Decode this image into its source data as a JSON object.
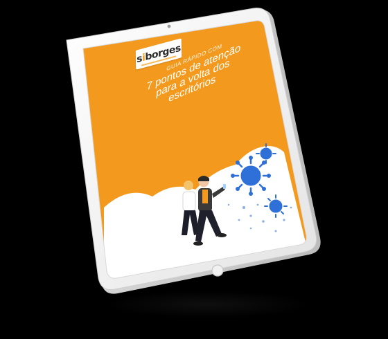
{
  "logo": {
    "brand_prefix": "s",
    "brand_accent": "i",
    "brand_suffix": "borges"
  },
  "cover": {
    "eyebrow": "GUIA RÁPIDO COM",
    "headline_line1": "7 pontos de atenção",
    "headline_line2": "para a volta dos",
    "headline_line3": "escritórios"
  },
  "colors": {
    "background": "#000000",
    "device_body": "#f4f4f4",
    "screen_orange": "#f39a1e",
    "virus_blue": "#2f6fd8",
    "ground_white": "#ffffff"
  },
  "icons": [
    "virus-icon",
    "home-button-icon",
    "camera-icon"
  ]
}
